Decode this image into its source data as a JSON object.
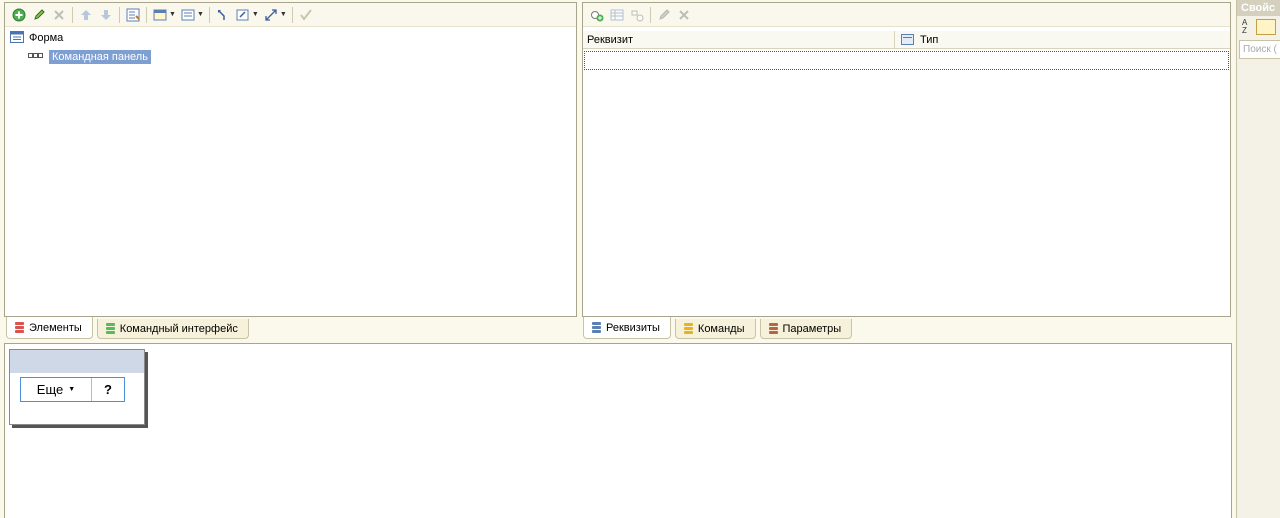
{
  "left_toolbar": {
    "icons": [
      "add-icon",
      "edit-icon",
      "delete-icon",
      "move-up-icon",
      "move-down-icon",
      "form-items-icon",
      "display-options-icon",
      "layout-options-icon",
      "move-to-parent-icon",
      "group-icon",
      "resize-icon",
      "check-icon"
    ]
  },
  "element_tree": {
    "root_label": "Форма",
    "child_label": "Командная панель"
  },
  "left_tabs": [
    {
      "label": "Элементы",
      "active": true
    },
    {
      "label": "Командный интерфейс",
      "active": false
    }
  ],
  "right_toolbar": {
    "icons": [
      "add-attribute-icon",
      "add-table-icon",
      "add-column-icon",
      "edit-icon",
      "delete-icon"
    ]
  },
  "attributes_table": {
    "columns": [
      "Реквизит",
      "Тип"
    ]
  },
  "right_tabs": [
    {
      "label": "Реквизиты",
      "active": true
    },
    {
      "label": "Команды",
      "active": false
    },
    {
      "label": "Параметры",
      "active": false
    }
  ],
  "preview": {
    "more_button": "Еще",
    "help_button": "?"
  },
  "properties_panel": {
    "title": "Свойс",
    "search_placeholder": "Поиск (",
    "sort_label": "AZ"
  },
  "colors": {
    "selection": "#7e9fd2",
    "panel_border": "#a9a48c",
    "background": "#fbf9ec"
  }
}
